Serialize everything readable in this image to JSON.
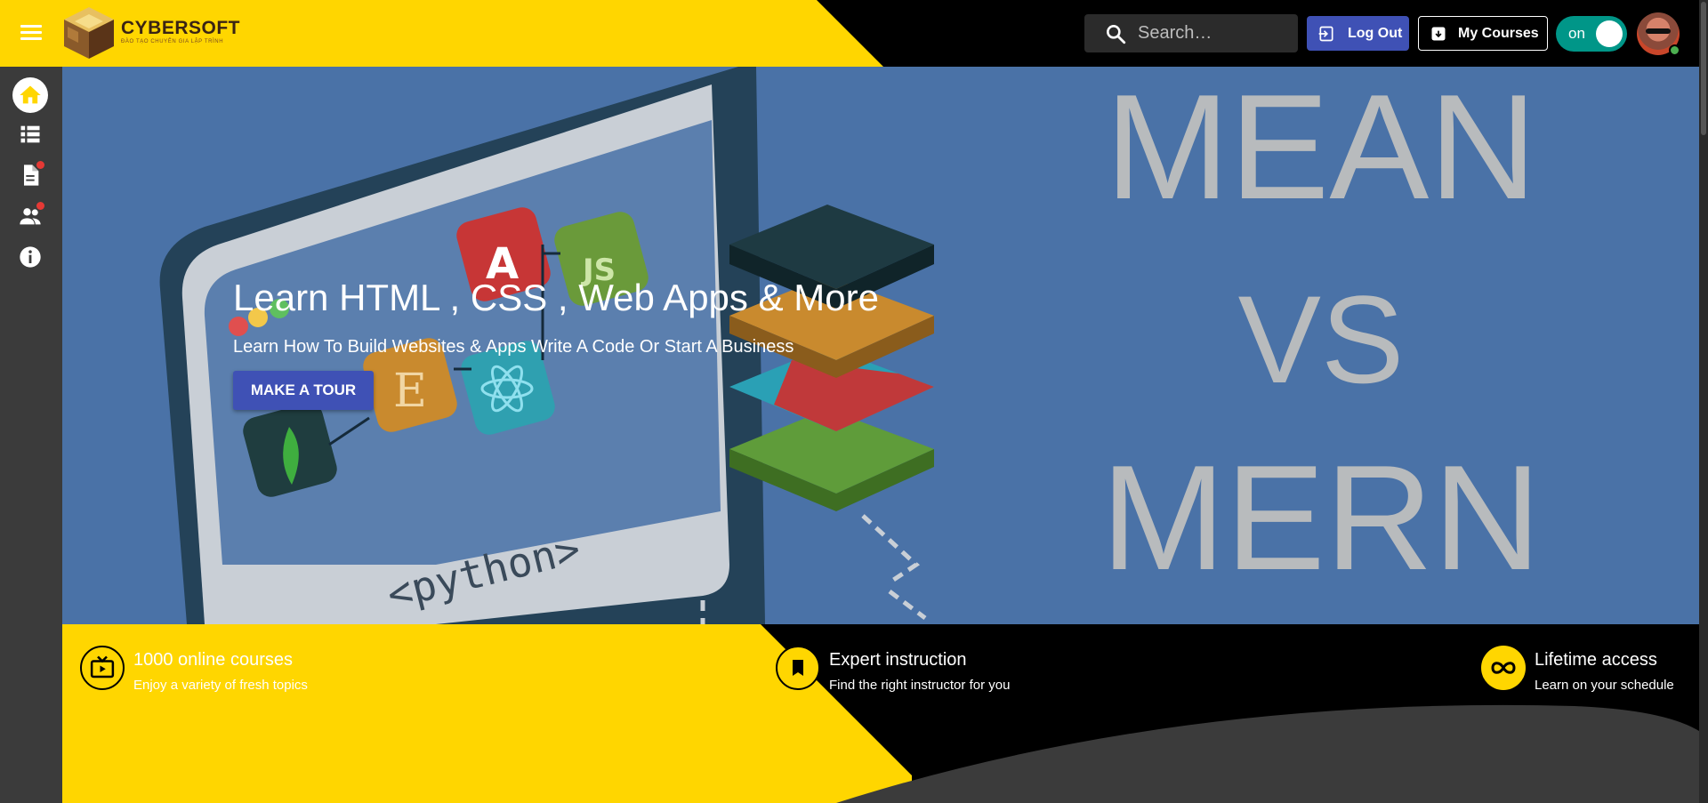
{
  "header": {
    "logo_name": "CYBERSOFT",
    "logo_sub": "ĐÀO TẠO CHUYÊN GIA LẬP TRÌNH",
    "search_placeholder": "Search…",
    "logout_label": "Log Out",
    "courses_label": "My Courses",
    "toggle_label": "on"
  },
  "sidebar": {
    "items": [
      {
        "name": "home-icon",
        "badge": false
      },
      {
        "name": "list-icon",
        "badge": false
      },
      {
        "name": "document-icon",
        "badge": true
      },
      {
        "name": "people-icon",
        "badge": true
      },
      {
        "name": "info-icon",
        "badge": false
      }
    ]
  },
  "hero": {
    "title": "Learn HTML , CSS , Web Apps & More",
    "subtitle": "Learn How To Build Websites & Apps Write A Code Or Start A Business",
    "button_label": "MAKE A TOUR",
    "image_text_top": "MEAN",
    "image_text_mid": "VS",
    "image_text_bottom": "MERN",
    "image_code_text": "<python>"
  },
  "features": [
    {
      "title": "1000 online courses",
      "desc": "Enjoy a variety of fresh topics",
      "icon": "tv-play-icon"
    },
    {
      "title": "Expert instruction",
      "desc": "Find the right instructor for you",
      "icon": "bookmark-icon"
    },
    {
      "title": "Lifetime access",
      "desc": "Learn on your schedule",
      "icon": "infinity-icon"
    }
  ],
  "colors": {
    "brand_yellow": "#ffd600",
    "primary_blue": "#3f51b5",
    "toggle_teal": "#009688",
    "sidebar_bg": "#3b3b3b"
  }
}
